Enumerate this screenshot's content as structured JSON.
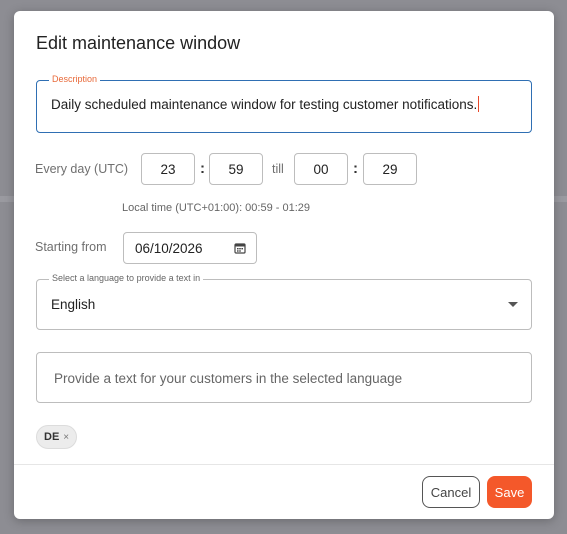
{
  "dialog": {
    "title": "Edit maintenance window",
    "description": {
      "label": "Description",
      "value": "Daily scheduled maintenance window for testing customer notifications."
    },
    "schedule": {
      "label": "Every day (UTC)",
      "start_hour": "23",
      "start_minute": "59",
      "separator": ":",
      "till_label": "till",
      "end_hour": "00",
      "end_minute": "29",
      "local_time": "Local time (UTC+01:00): 00:59 - 01:29"
    },
    "start": {
      "label": "Starting from",
      "date": "06/10/2026",
      "icon": "calendar-icon"
    },
    "language": {
      "label": "Select a language to provide a text in",
      "value": "English",
      "icon": "chevron-down-icon"
    },
    "customer_text": {
      "placeholder": "Provide a text for your customers in the selected language"
    },
    "chips": [
      {
        "label": "DE",
        "remove": "×"
      }
    ],
    "actions": {
      "cancel_label": "Cancel",
      "save_label": "Save"
    }
  },
  "colors": {
    "accent": "#f4582a",
    "focus_border": "#2f6fb3",
    "label_accent": "#e86a3a"
  }
}
